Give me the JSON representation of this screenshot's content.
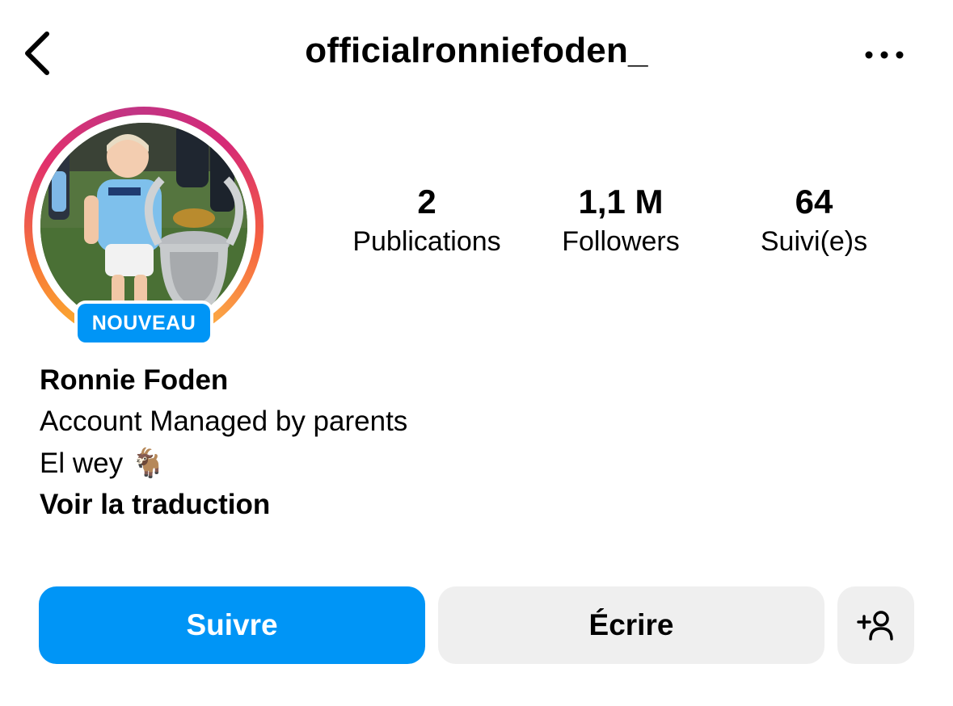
{
  "header": {
    "username": "officialronniefoden_",
    "back_icon": "chevron-left-icon",
    "more_icon": "more-horizontal-icon"
  },
  "profile": {
    "badge_label": "NOUVEAU",
    "stats": [
      {
        "count": "2",
        "label": "Publications"
      },
      {
        "count": "1,1 M",
        "label": "Followers"
      },
      {
        "count": "64",
        "label": "Suivi(e)s"
      }
    ]
  },
  "bio": {
    "name": "Ronnie Foden",
    "line1": "Account Managed by parents",
    "line2": "El wey 🐐",
    "translate_link": "Voir la traduction"
  },
  "actions": {
    "follow_label": "Suivre",
    "message_label": "Écrire",
    "add_user_icon": "add-user-icon"
  },
  "colors": {
    "accent": "#0095f6",
    "secondary_button": "#efefef"
  }
}
